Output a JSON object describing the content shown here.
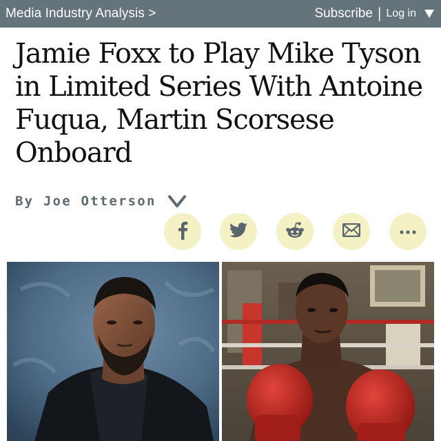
{
  "topbar": {
    "section_link": "Media Industry Analysis >",
    "subscribe_label": "Subscribe",
    "separator": "|",
    "login_label": "Log in",
    "background": "#65737a"
  },
  "article": {
    "headline": "Jamie Foxx to Play Mike Tyson in Limited Series With Antoine Fuqua, Martin Scorsese Onboard",
    "byline": "By Joe Otterson"
  },
  "share": {
    "background": "#f4f2c4",
    "icon_color": "#5a666d",
    "buttons": [
      {
        "icon": "facebook-icon"
      },
      {
        "icon": "twitter-icon"
      },
      {
        "icon": "reddit-icon"
      },
      {
        "icon": "email-icon"
      },
      {
        "icon": "more-icon"
      }
    ]
  },
  "photos": [
    {
      "subject": "portrait-photo"
    },
    {
      "subject": "boxer-photo"
    }
  ]
}
